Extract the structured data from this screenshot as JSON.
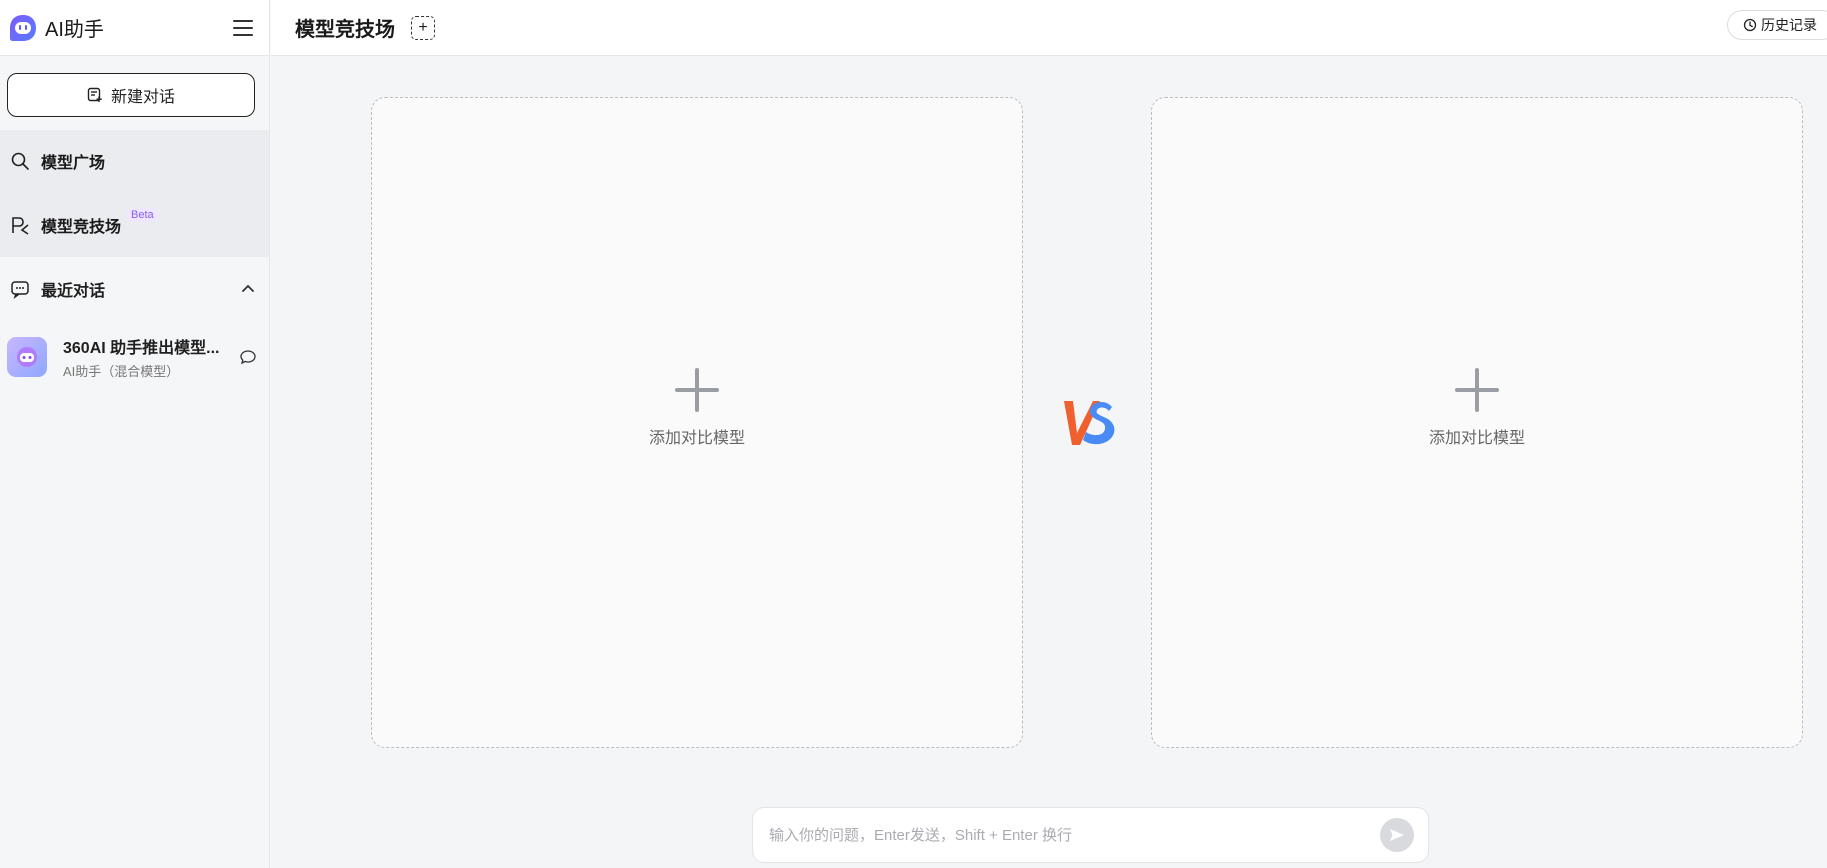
{
  "brand": {
    "name": "AI助手"
  },
  "sidebar": {
    "new_chat_label": "新建对话",
    "nav_items": [
      {
        "label": "模型广场",
        "icon": "search-icon"
      },
      {
        "label": "模型竞技场",
        "icon": "arena-icon",
        "badge": "Beta"
      }
    ],
    "recent_label": "最近对话",
    "conversations": [
      {
        "title": "360AI 助手推出模型...",
        "subtitle": "AI助手（混合模型）"
      }
    ]
  },
  "header": {
    "title": "模型竞技场",
    "history_label": "历史记录"
  },
  "compare": {
    "left_label": "添加对比模型",
    "right_label": "添加对比模型",
    "vs_colors": {
      "v": "#f0602f",
      "s": "#4a8af4"
    }
  },
  "composer": {
    "placeholder": "输入你的问题，Enter发送，Shift + Enter 换行"
  }
}
